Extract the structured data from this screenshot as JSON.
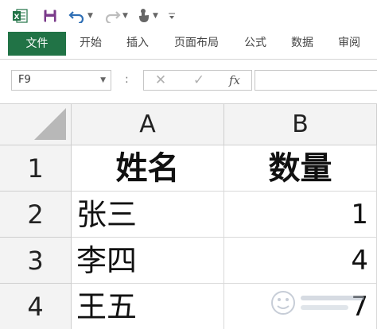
{
  "quick_access": {
    "app_icon": "excel-icon",
    "save_icon": "save-icon",
    "undo_icon": "undo-icon",
    "redo_icon": "redo-icon",
    "touch_mode_icon": "touch-mode-icon",
    "customize_icon": "customize-qat-icon",
    "app_icon_letter": "X"
  },
  "ribbon": {
    "tabs": [
      {
        "label": "文件",
        "active": true
      },
      {
        "label": "开始"
      },
      {
        "label": "插入"
      },
      {
        "label": "页面布局"
      },
      {
        "label": "公式"
      },
      {
        "label": "数据"
      },
      {
        "label": "审阅"
      }
    ],
    "accent_color": "#217346"
  },
  "formula_bar": {
    "name_box_value": "F9",
    "separator": ":",
    "cancel_icon": "close-icon",
    "enter_icon": "check-icon",
    "insert_function_label": "fx",
    "formula_value": ""
  },
  "grid": {
    "columns": [
      "A",
      "B"
    ],
    "rows": [
      "1",
      "2",
      "3",
      "4"
    ],
    "cells": [
      [
        "姓名",
        "数量"
      ],
      [
        "张三",
        "1"
      ],
      [
        "李四",
        "4"
      ],
      [
        "王五",
        "7"
      ]
    ]
  },
  "watermark": {
    "icon": "baidu-jingyan-logo"
  }
}
